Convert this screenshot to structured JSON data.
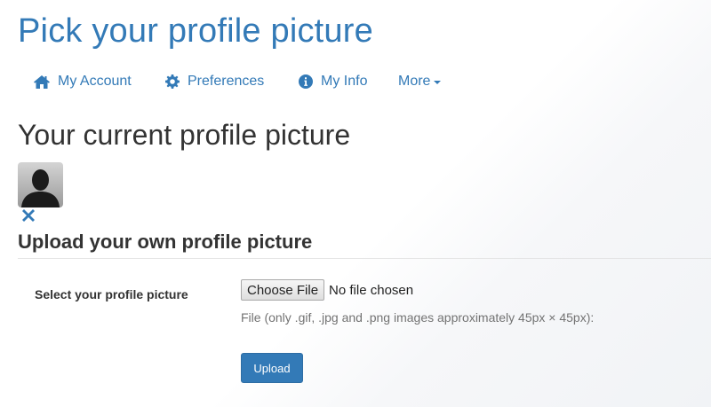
{
  "page": {
    "title": "Pick your profile picture"
  },
  "nav": {
    "items": [
      {
        "label": "My Account",
        "icon": "home-icon"
      },
      {
        "label": "Preferences",
        "icon": "gear-icon"
      },
      {
        "label": "My Info",
        "icon": "info-circle-icon"
      },
      {
        "label": "More",
        "icon": "caret-down-icon"
      }
    ]
  },
  "current": {
    "heading": "Your current profile picture",
    "avatar_icon": "default-avatar-silhouette",
    "remove_icon": "remove-icon"
  },
  "upload": {
    "heading": "Upload your own profile picture",
    "field_label": "Select your profile picture",
    "choose_button": "Choose File",
    "file_status": "No file chosen",
    "help_text": "File (only .gif, .jpg and .png images approximately 45px × 45px):",
    "submit_label": "Upload"
  },
  "colors": {
    "accent": "#337ab7",
    "text": "#333333",
    "muted": "#737373"
  }
}
